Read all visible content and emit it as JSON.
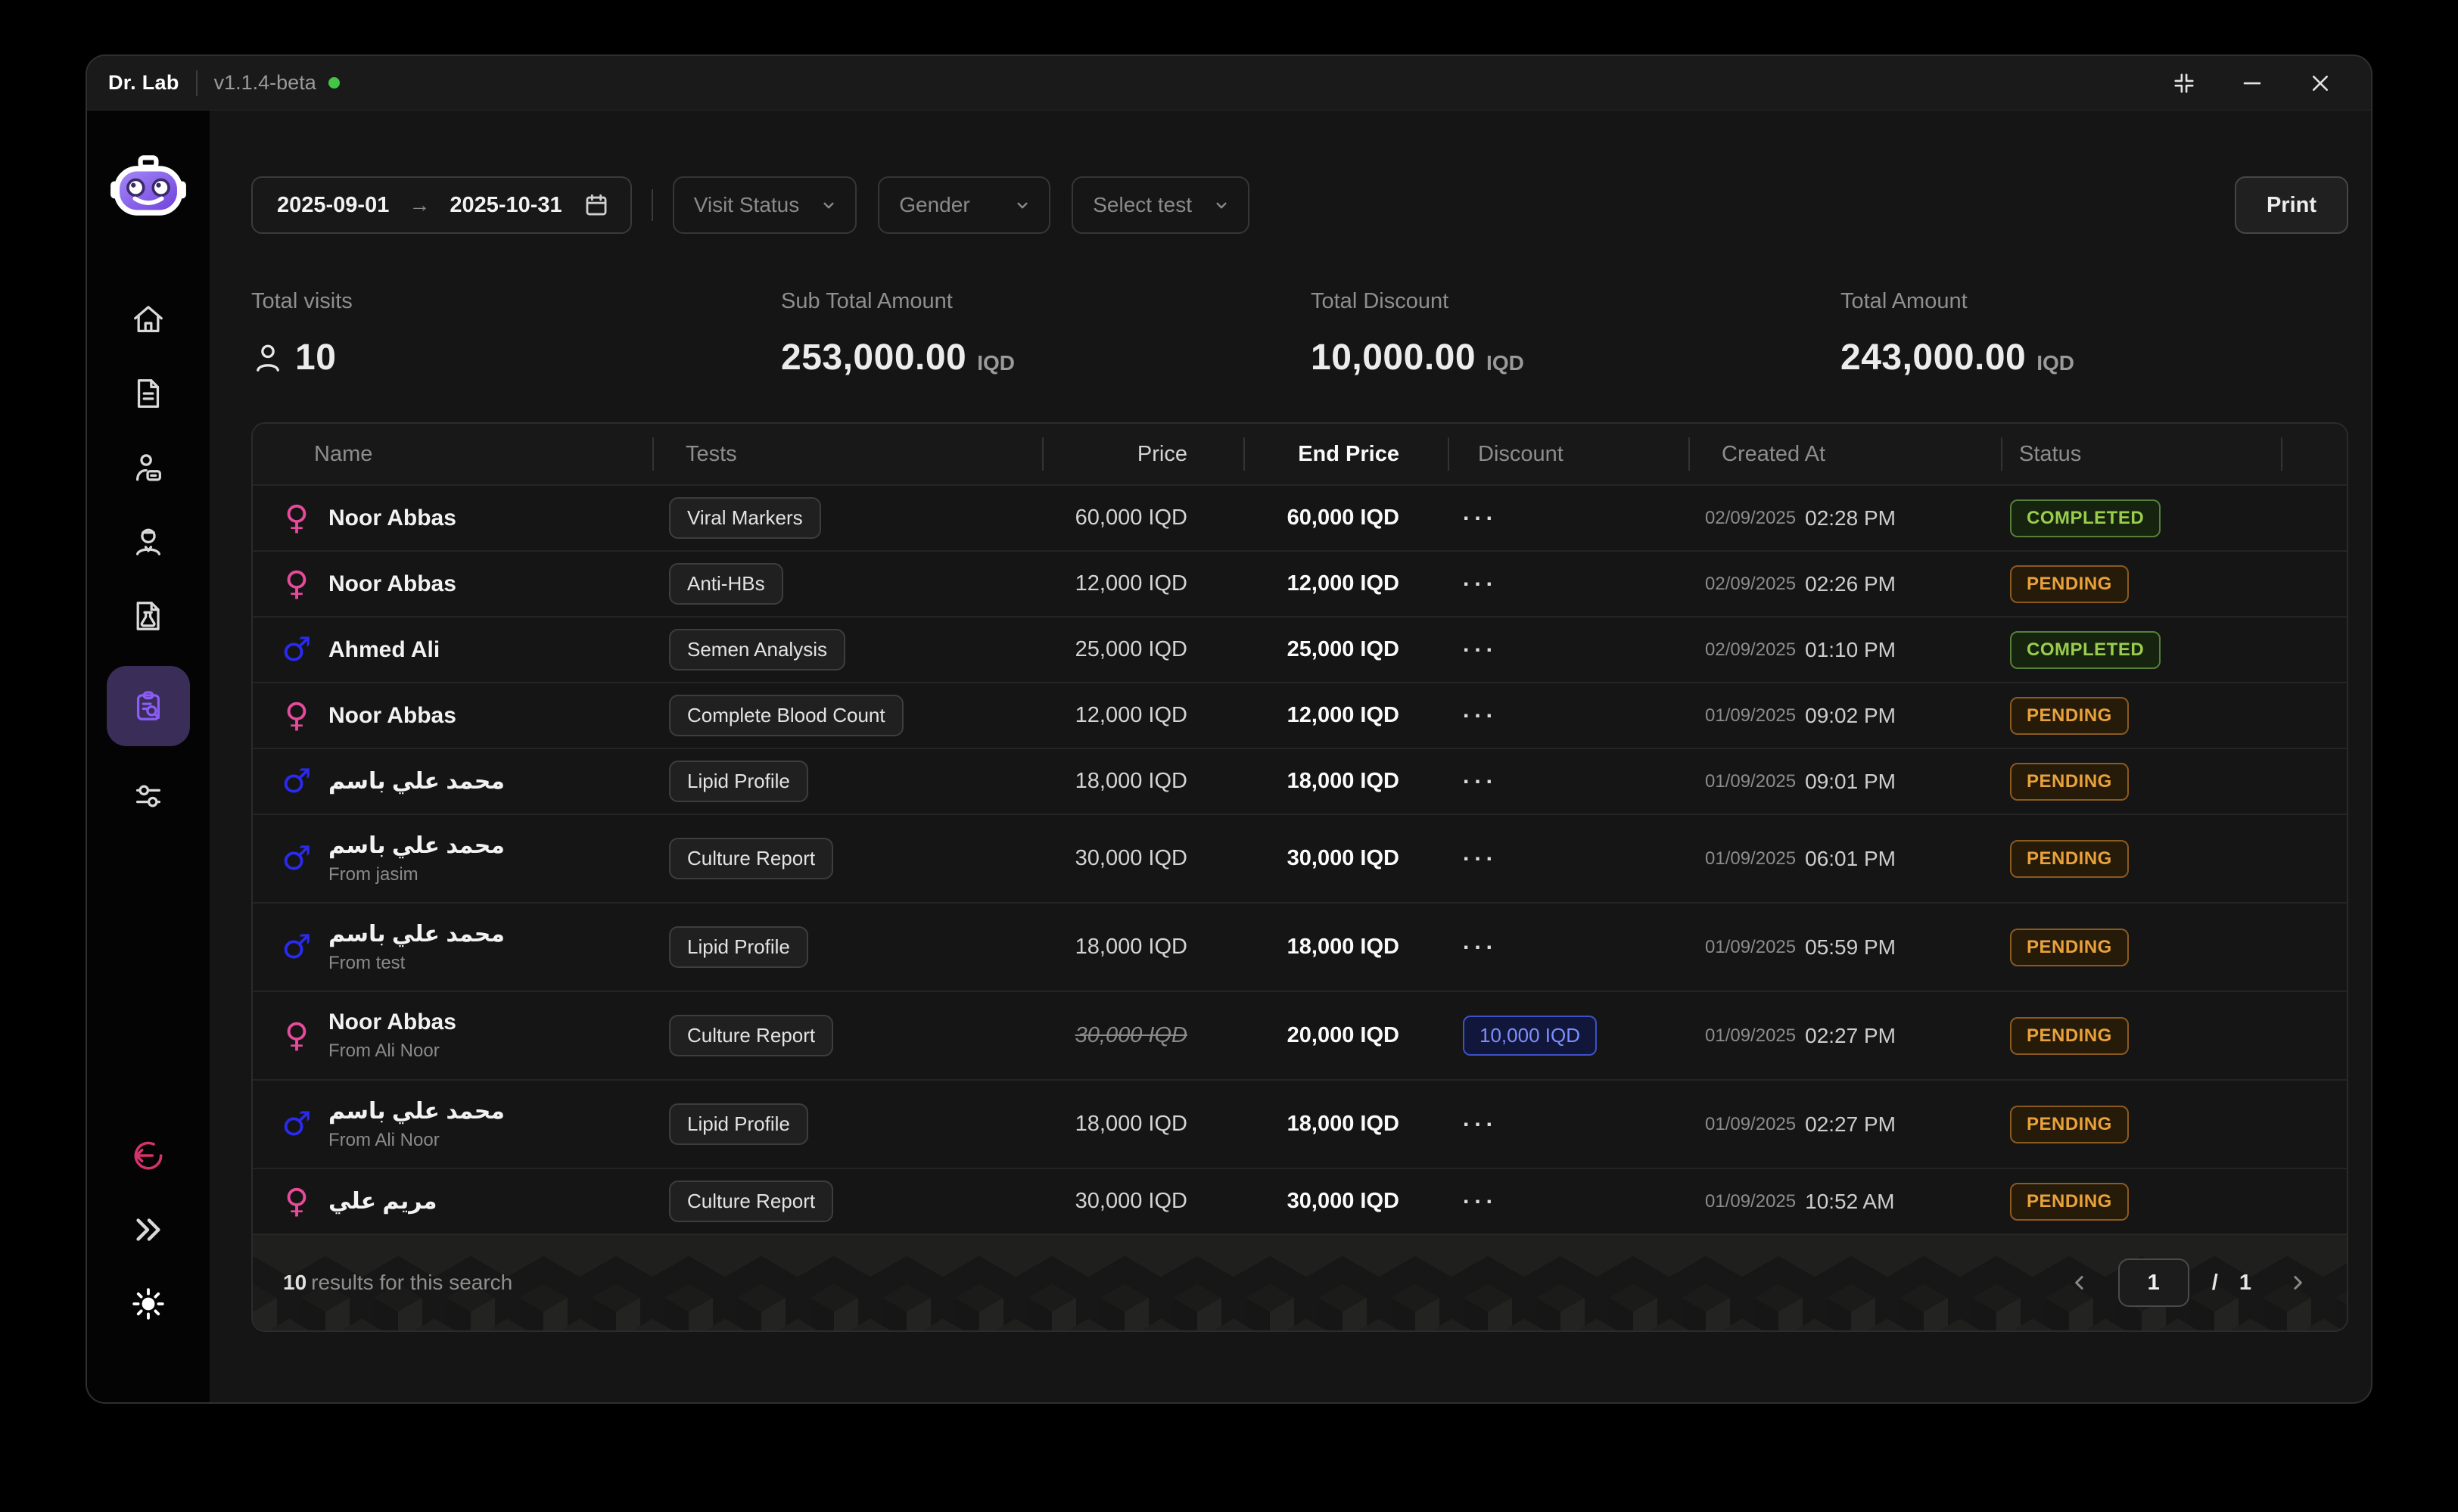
{
  "titlebar": {
    "app_name": "Dr. Lab",
    "version": "v1.1.4-beta"
  },
  "filters": {
    "date_from": "2025-09-01",
    "date_to": "2025-10-31",
    "visit_status_placeholder": "Visit Status",
    "gender_placeholder": "Gender",
    "select_test_placeholder": "Select test",
    "print_label": "Print"
  },
  "stats": [
    {
      "label": "Total visits",
      "value": "10",
      "unit": ""
    },
    {
      "label": "Sub Total Amount",
      "value": "253,000.00",
      "unit": "IQD"
    },
    {
      "label": "Total Discount",
      "value": "10,000.00",
      "unit": "IQD"
    },
    {
      "label": "Total Amount",
      "value": "243,000.00",
      "unit": "IQD"
    }
  ],
  "table": {
    "columns": [
      "Name",
      "Tests",
      "Price",
      "End Price",
      "Discount",
      "Created At",
      "Status"
    ],
    "rows": [
      {
        "gender": "female",
        "name": "Noor Abbas",
        "subtitle": "",
        "test": "Viral Markers",
        "price": "60,000 IQD",
        "price_struck": false,
        "end_price": "60,000 IQD",
        "discount": "...",
        "discount_is_badge": false,
        "date": "02/09/2025",
        "time": "02:28 PM",
        "status": "COMPLETED"
      },
      {
        "gender": "female",
        "name": "Noor Abbas",
        "subtitle": "",
        "test": "Anti-HBs",
        "price": "12,000 IQD",
        "price_struck": false,
        "end_price": "12,000 IQD",
        "discount": "...",
        "discount_is_badge": false,
        "date": "02/09/2025",
        "time": "02:26 PM",
        "status": "PENDING"
      },
      {
        "gender": "male",
        "name": "Ahmed Ali",
        "subtitle": "",
        "test": "Semen Analysis",
        "price": "25,000 IQD",
        "price_struck": false,
        "end_price": "25,000 IQD",
        "discount": "...",
        "discount_is_badge": false,
        "date": "02/09/2025",
        "time": "01:10 PM",
        "status": "COMPLETED"
      },
      {
        "gender": "female",
        "name": "Noor Abbas",
        "subtitle": "",
        "test": "Complete Blood Count",
        "price": "12,000 IQD",
        "price_struck": false,
        "end_price": "12,000 IQD",
        "discount": "...",
        "discount_is_badge": false,
        "date": "01/09/2025",
        "time": "09:02 PM",
        "status": "PENDING"
      },
      {
        "gender": "male",
        "name": "محمد علي باسم",
        "subtitle": "",
        "test": "Lipid Profile",
        "price": "18,000 IQD",
        "price_struck": false,
        "end_price": "18,000 IQD",
        "discount": "...",
        "discount_is_badge": false,
        "date": "01/09/2025",
        "time": "09:01 PM",
        "status": "PENDING"
      },
      {
        "gender": "male",
        "name": "محمد علي باسم",
        "subtitle": "From jasim",
        "test": "Culture Report",
        "price": "30,000 IQD",
        "price_struck": false,
        "end_price": "30,000 IQD",
        "discount": "...",
        "discount_is_badge": false,
        "date": "01/09/2025",
        "time": "06:01 PM",
        "status": "PENDING"
      },
      {
        "gender": "male",
        "name": "محمد علي باسم",
        "subtitle": "From test",
        "test": "Lipid Profile",
        "price": "18,000 IQD",
        "price_struck": false,
        "end_price": "18,000 IQD",
        "discount": "...",
        "discount_is_badge": false,
        "date": "01/09/2025",
        "time": "05:59 PM",
        "status": "PENDING"
      },
      {
        "gender": "female",
        "name": "Noor Abbas",
        "subtitle": "From Ali Noor",
        "test": "Culture Report",
        "price": "30,000 IQD",
        "price_struck": true,
        "end_price": "20,000 IQD",
        "discount": "10,000 IQD",
        "discount_is_badge": true,
        "date": "01/09/2025",
        "time": "02:27 PM",
        "status": "PENDING"
      },
      {
        "gender": "male",
        "name": "محمد علي باسم",
        "subtitle": "From Ali Noor",
        "test": "Lipid Profile",
        "price": "18,000 IQD",
        "price_struck": false,
        "end_price": "18,000 IQD",
        "discount": "...",
        "discount_is_badge": false,
        "date": "01/09/2025",
        "time": "02:27 PM",
        "status": "PENDING"
      },
      {
        "gender": "female",
        "name": "مريم علي",
        "subtitle": "",
        "test": "Culture Report",
        "price": "30,000 IQD",
        "price_struck": false,
        "end_price": "30,000 IQD",
        "discount": "...",
        "discount_is_badge": false,
        "date": "01/09/2025",
        "time": "10:52 AM",
        "status": "PENDING"
      }
    ]
  },
  "footer": {
    "results_count": "10",
    "results_text": "results for this search",
    "current_page": "1",
    "page_total": "/ 1"
  }
}
